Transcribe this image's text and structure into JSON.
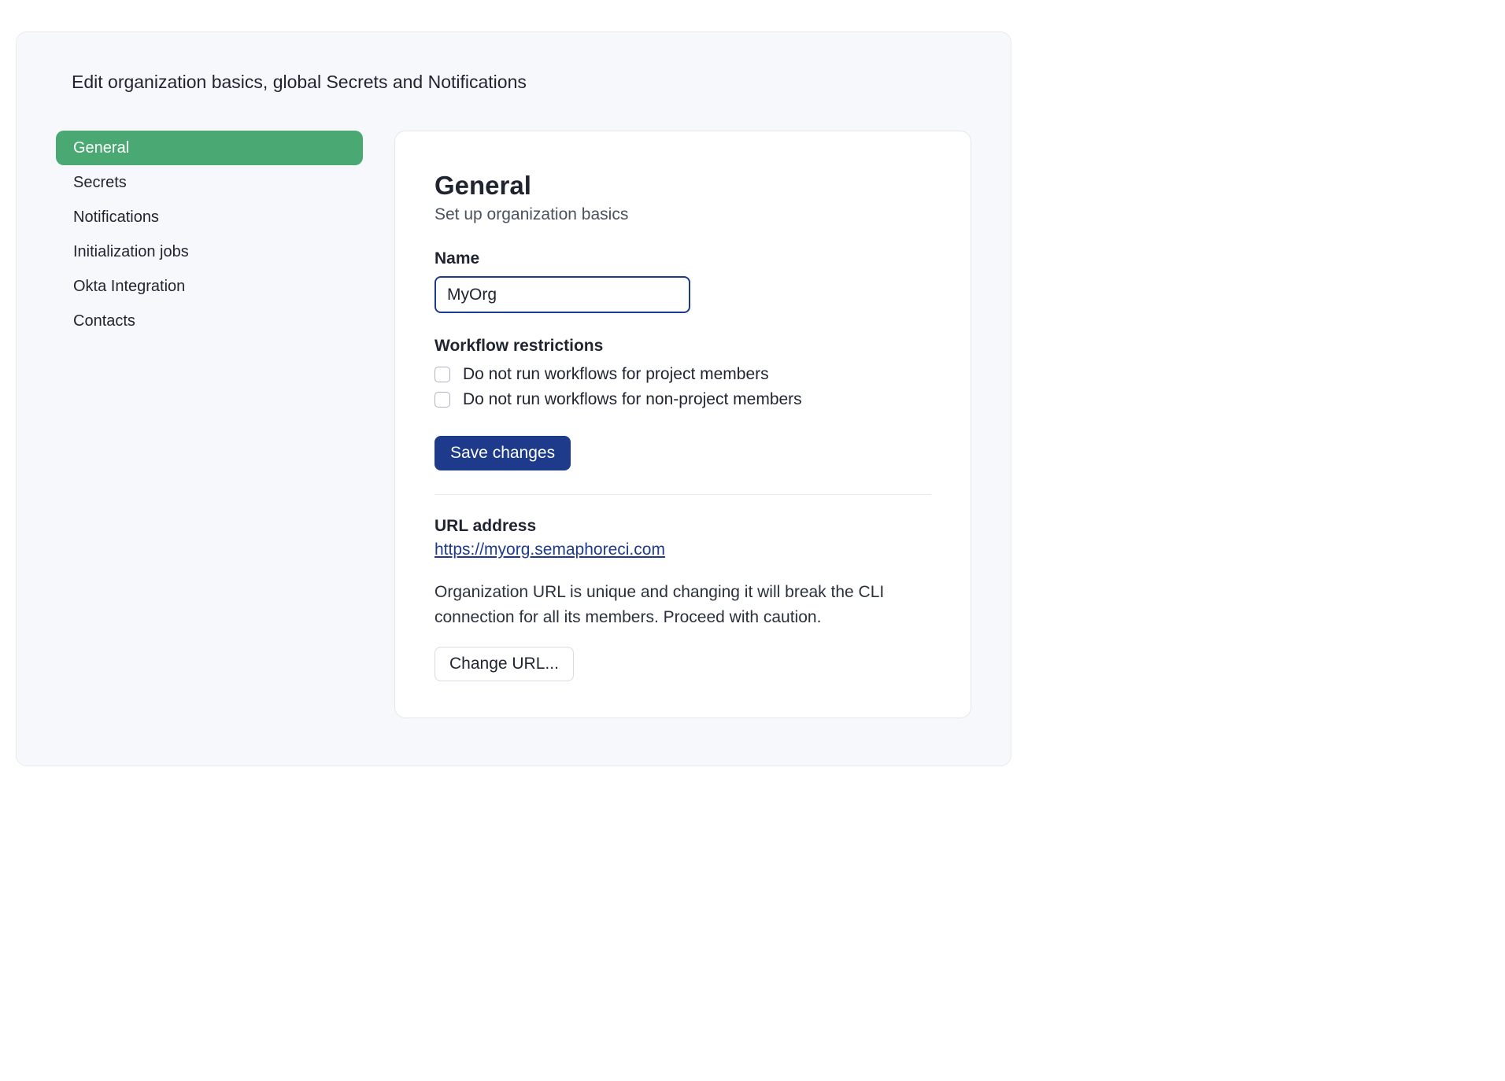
{
  "page": {
    "title": "Edit organization basics, global Secrets and Notifications"
  },
  "sidebar": {
    "items": [
      {
        "label": "General",
        "active": true
      },
      {
        "label": "Secrets",
        "active": false
      },
      {
        "label": "Notifications",
        "active": false
      },
      {
        "label": "Initialization jobs",
        "active": false
      },
      {
        "label": "Okta Integration",
        "active": false
      },
      {
        "label": "Contacts",
        "active": false
      }
    ]
  },
  "general": {
    "heading": "General",
    "subtitle": "Set up organization basics",
    "name_label": "Name",
    "name_value": "MyOrg",
    "workflow_restrictions_label": "Workflow restrictions",
    "restrictions": [
      {
        "label": "Do not run workflows for project members",
        "checked": false
      },
      {
        "label": "Do not run workflows for non-project members",
        "checked": false
      }
    ],
    "save_button": "Save changes",
    "url_address_label": "URL address",
    "url_value": "https://myorg.semaphoreci.com",
    "url_note": "Organization URL is unique and changing it will break the CLI connection for all its members. Proceed with caution.",
    "change_url_button": "Change URL..."
  }
}
